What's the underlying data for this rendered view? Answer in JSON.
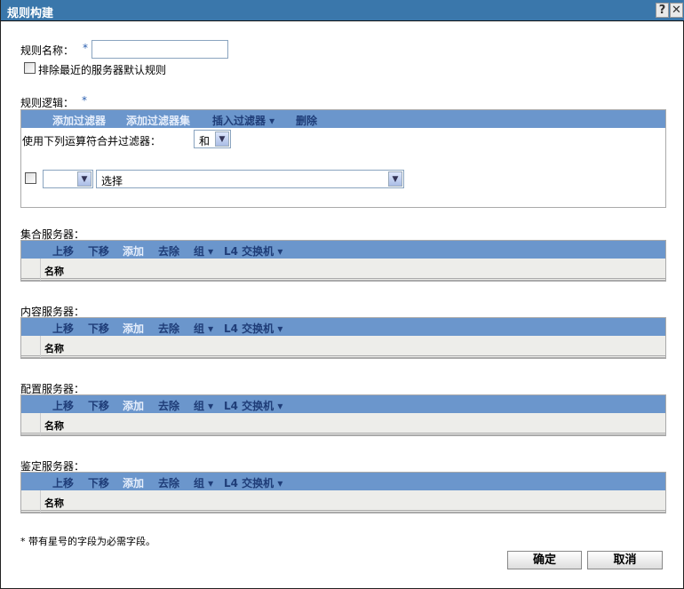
{
  "title": "规则构建",
  "help_label": "?",
  "close_label": "✕",
  "rule_name": {
    "label": "规则名称：",
    "required": "*",
    "value": ""
  },
  "exclude_checkbox": {
    "label": "排除最近的服务器默认规则",
    "checked": false
  },
  "rule_logic": {
    "label": "规则逻辑：",
    "required": "*",
    "toolbar": {
      "add_filter": "添加过滤器",
      "add_filter_set": "添加过滤器集",
      "insert_filter": "插入过滤器 ▾",
      "delete": "删除"
    },
    "combine_label": "使用下列运算符合并过滤器：",
    "combine_value": "和",
    "row": {
      "operator_value": "",
      "filter_value": "选择"
    }
  },
  "sections": [
    {
      "label": "集合服务器：",
      "up": "上移",
      "down": "下移",
      "add": "添加",
      "remove": "去除",
      "group": "组 ▾",
      "l4": "L4 交换机 ▾",
      "column": "名称"
    },
    {
      "label": "内容服务器：",
      "up": "上移",
      "down": "下移",
      "add": "添加",
      "remove": "去除",
      "group": "组 ▾",
      "l4": "L4 交换机 ▾",
      "column": "名称"
    },
    {
      "label": "配置服务器：",
      "up": "上移",
      "down": "下移",
      "add": "添加",
      "remove": "去除",
      "group": "组 ▾",
      "l4": "L4 交换机 ▾",
      "column": "名称"
    },
    {
      "label": "鉴定服务器：",
      "up": "上移",
      "down": "下移",
      "add": "添加",
      "remove": "去除",
      "group": "组 ▾",
      "l4": "L4 交换机 ▾",
      "column": "名称"
    }
  ],
  "footer_note": "* 带有星号的字段为必需字段。",
  "ok_label": "确定",
  "cancel_label": "取消"
}
